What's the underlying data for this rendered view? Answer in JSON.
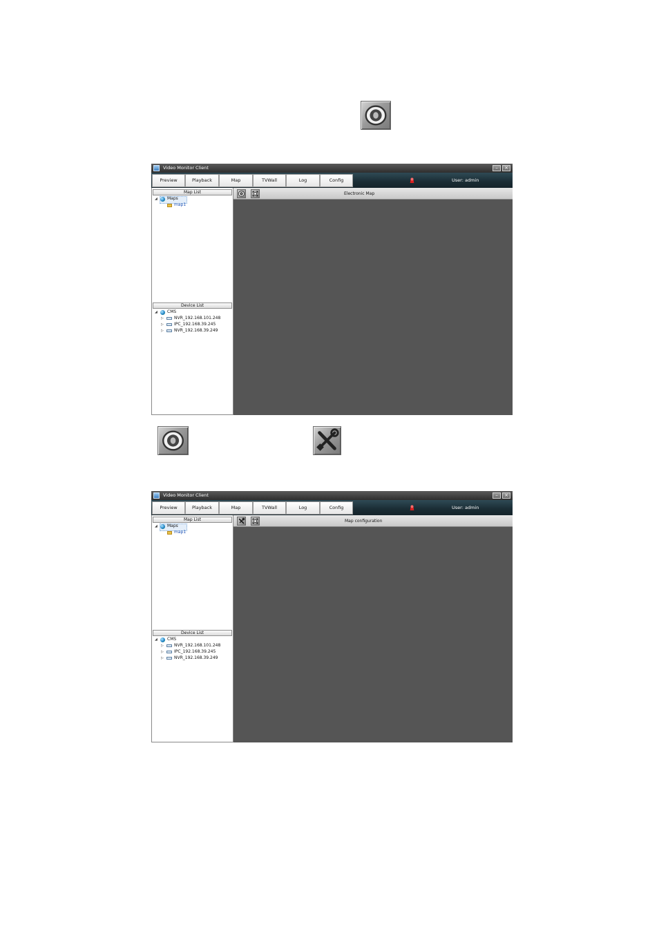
{
  "window": {
    "title": "Video Monitor Client",
    "minimize_glyph": "–",
    "close_glyph": "×"
  },
  "nav": {
    "tabs": [
      "Preview",
      "Playback",
      "Map",
      "TVWall",
      "Log",
      "Config"
    ],
    "user_label": "User: admin"
  },
  "map_list": {
    "header": "Map List",
    "root": "Maps",
    "items": [
      "map1"
    ]
  },
  "device_list": {
    "header": "Device List",
    "root": "CMS",
    "items": [
      "NVR_192.168.101.248",
      "IPC_192.168.39.245",
      "NVR_192.168.39.249"
    ]
  },
  "screens": [
    {
      "toolbar_title": "Electronic Map",
      "first_icon": "eye-icon"
    },
    {
      "toolbar_title": "Map configuration",
      "first_icon": "tools-icon"
    }
  ],
  "standalone_icons": [
    "eye-icon",
    "eye-icon",
    "tools-icon"
  ],
  "colors": {
    "nav_bar": "#1a2c34",
    "map_canvas": "#555555",
    "map_link": "#1a4fb5"
  }
}
